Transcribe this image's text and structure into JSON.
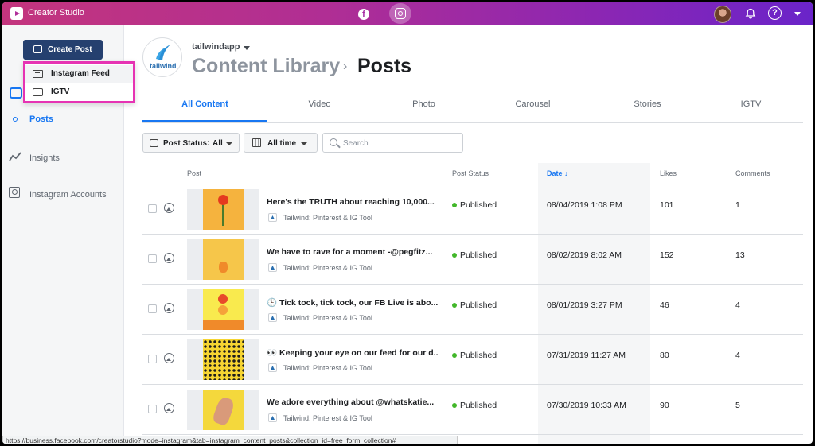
{
  "app": {
    "title": "Creator Studio"
  },
  "sidebar": {
    "create_post_label": "Create Post",
    "create_menu": [
      {
        "label": "Instagram Feed",
        "icon": "feed-icon"
      },
      {
        "label": "IGTV",
        "icon": "tv-icon"
      }
    ],
    "items": [
      {
        "label": "Posts",
        "icon": "content-library-icon",
        "active": true
      },
      {
        "label": "Insights",
        "icon": "insights-icon"
      },
      {
        "label": "Instagram Accounts",
        "icon": "accounts-icon"
      }
    ]
  },
  "header": {
    "account_name": "tailwindapp",
    "brand_logo_text": "tailwind",
    "breadcrumb_root": "Content Library",
    "breadcrumb_separator": "›",
    "breadcrumb_current": "Posts"
  },
  "tabs": [
    "All Content",
    "Video",
    "Photo",
    "Carousel",
    "Stories",
    "IGTV"
  ],
  "filters": {
    "status_label": "Post Status:",
    "status_value": "All",
    "time_value": "All time",
    "search_placeholder": "Search"
  },
  "table": {
    "columns": [
      "Post",
      "Post Status",
      "Date ↓",
      "Likes",
      "Comments"
    ],
    "rows": [
      {
        "title": "Here's the TRUTH about reaching 10,000...",
        "source": "Tailwind: Pinterest & IG Tool",
        "status": "Published",
        "date": "08/04/2019 1:08 PM",
        "likes": "101",
        "comments": "1"
      },
      {
        "title": "We have to rave for a moment -@pegfitz...",
        "source": "Tailwind: Pinterest & IG Tool",
        "status": "Published",
        "date": "08/02/2019 8:02 AM",
        "likes": "152",
        "comments": "13"
      },
      {
        "title": "🕒 Tick tock, tick tock, our FB Live is abo...",
        "source": "Tailwind: Pinterest & IG Tool",
        "status": "Published",
        "date": "08/01/2019 3:27 PM",
        "likes": "46",
        "comments": "4"
      },
      {
        "title": "👀 Keeping your eye on our feed for our d...",
        "source": "Tailwind: Pinterest & IG Tool",
        "status": "Published",
        "date": "07/31/2019 11:27 AM",
        "likes": "80",
        "comments": "4"
      },
      {
        "title": "We adore everything about @whatskatie...",
        "source": "Tailwind: Pinterest & IG Tool",
        "status": "Published",
        "date": "07/30/2019 10:33 AM",
        "likes": "90",
        "comments": "5"
      }
    ]
  },
  "status_bar_url": "https://business.facebook.com/creatorstudio?mode=instagram&tab=instagram_content_posts&collection_id=free_form_collection#",
  "colors": {
    "accent": "#1877f2",
    "published": "#42b72a",
    "highlight": "#e633b3",
    "create_button": "#25406f"
  }
}
